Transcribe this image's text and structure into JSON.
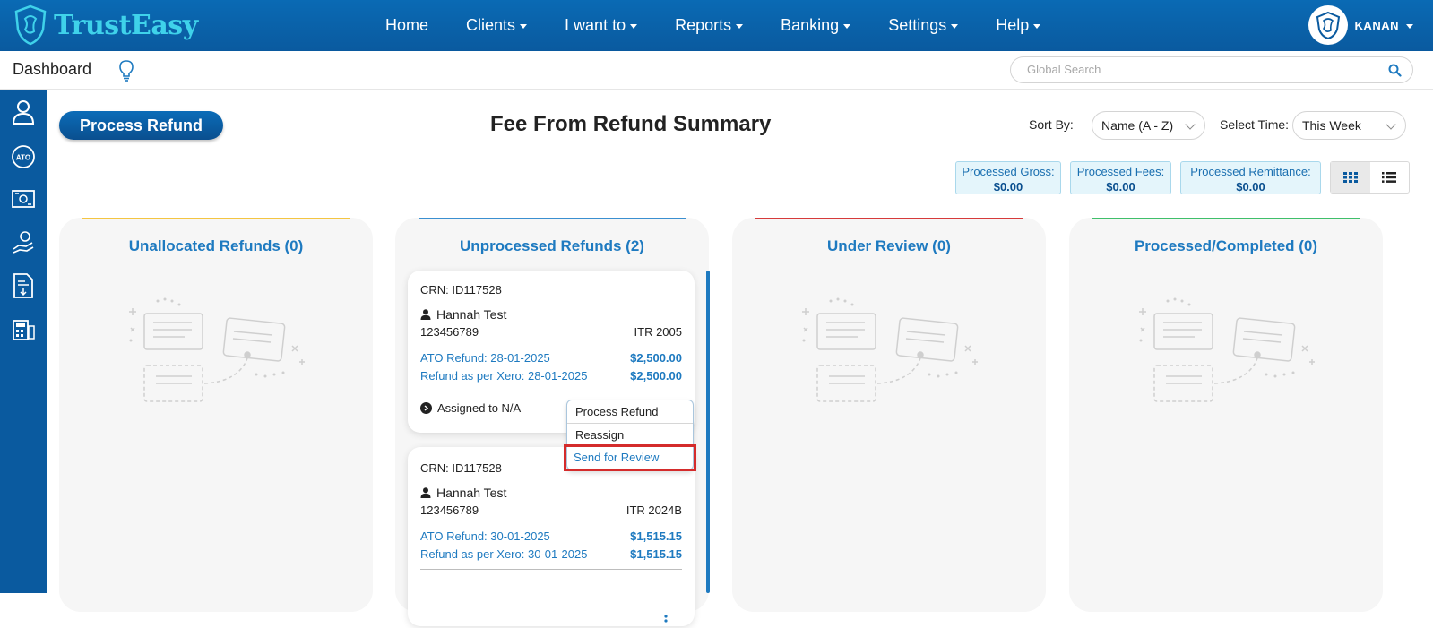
{
  "app": {
    "brand": "TrustEasy"
  },
  "nav": {
    "items": [
      {
        "label": "Home",
        "dropdown": false
      },
      {
        "label": "Clients",
        "dropdown": true
      },
      {
        "label": "I want to",
        "dropdown": true
      },
      {
        "label": "Reports",
        "dropdown": true
      },
      {
        "label": "Banking",
        "dropdown": true
      },
      {
        "label": "Settings",
        "dropdown": true
      },
      {
        "label": "Help",
        "dropdown": true
      }
    ],
    "user": "KANAN"
  },
  "subbar": {
    "title": "Dashboard",
    "search_placeholder": "Global Search"
  },
  "sidebar": {
    "icons": [
      "user-icon",
      "ato-icon",
      "money-transfer-icon",
      "hand-money-icon",
      "document-download-icon",
      "calculator-icon"
    ],
    "ato_label": "ATO"
  },
  "main": {
    "process_refund_label": "Process Refund",
    "title": "Fee From Refund Summary",
    "sort_by_label": "Sort By:",
    "sort_by_value": "Name (A - Z)",
    "select_time_label": "Select Time:",
    "select_time_value": "This Week",
    "stats": [
      {
        "label": "Processed Gross:",
        "value": "$0.00"
      },
      {
        "label": "Processed Fees:",
        "value": "$0.00"
      },
      {
        "label": "Processed Remittance:",
        "value": "$0.00"
      }
    ]
  },
  "columns": [
    {
      "title": "Unallocated Refunds (0)",
      "accent": "#f4c542"
    },
    {
      "title": "Unprocessed Refunds (2)",
      "accent": "#3a8fd0"
    },
    {
      "title": "Under Review (0)",
      "accent": "#d63b3b"
    },
    {
      "title": "Processed/Completed (0)",
      "accent": "#3fbf6a"
    }
  ],
  "cards": [
    {
      "crn": "CRN: ID117528",
      "client": "Hannah Test",
      "tfn": "123456789",
      "itr": "ITR 2005",
      "ato_refund_label": "ATO Refund: 28-01-2025",
      "ato_refund_value": "$2,500.00",
      "xero_refund_label": "Refund as per Xero: 28-01-2025",
      "xero_refund_value": "$2,500.00",
      "assigned": "Assigned to N/A"
    },
    {
      "crn": "CRN: ID117528",
      "client": "Hannah Test",
      "tfn": "123456789",
      "itr": "ITR 2024B",
      "ato_refund_label": "ATO Refund: 30-01-2025",
      "ato_refund_value": "$1,515.15",
      "xero_refund_label": "Refund as per Xero: 30-01-2025",
      "xero_refund_value": "$1,515.15"
    }
  ],
  "menu": {
    "items": [
      "Process Refund",
      "Reassign",
      "Send for Review"
    ],
    "highlighted": "Send for Review"
  },
  "colors": {
    "primary": "#0a5a9f",
    "accent_blue": "#1e7ac0",
    "highlight_red": "#d42b2b"
  }
}
